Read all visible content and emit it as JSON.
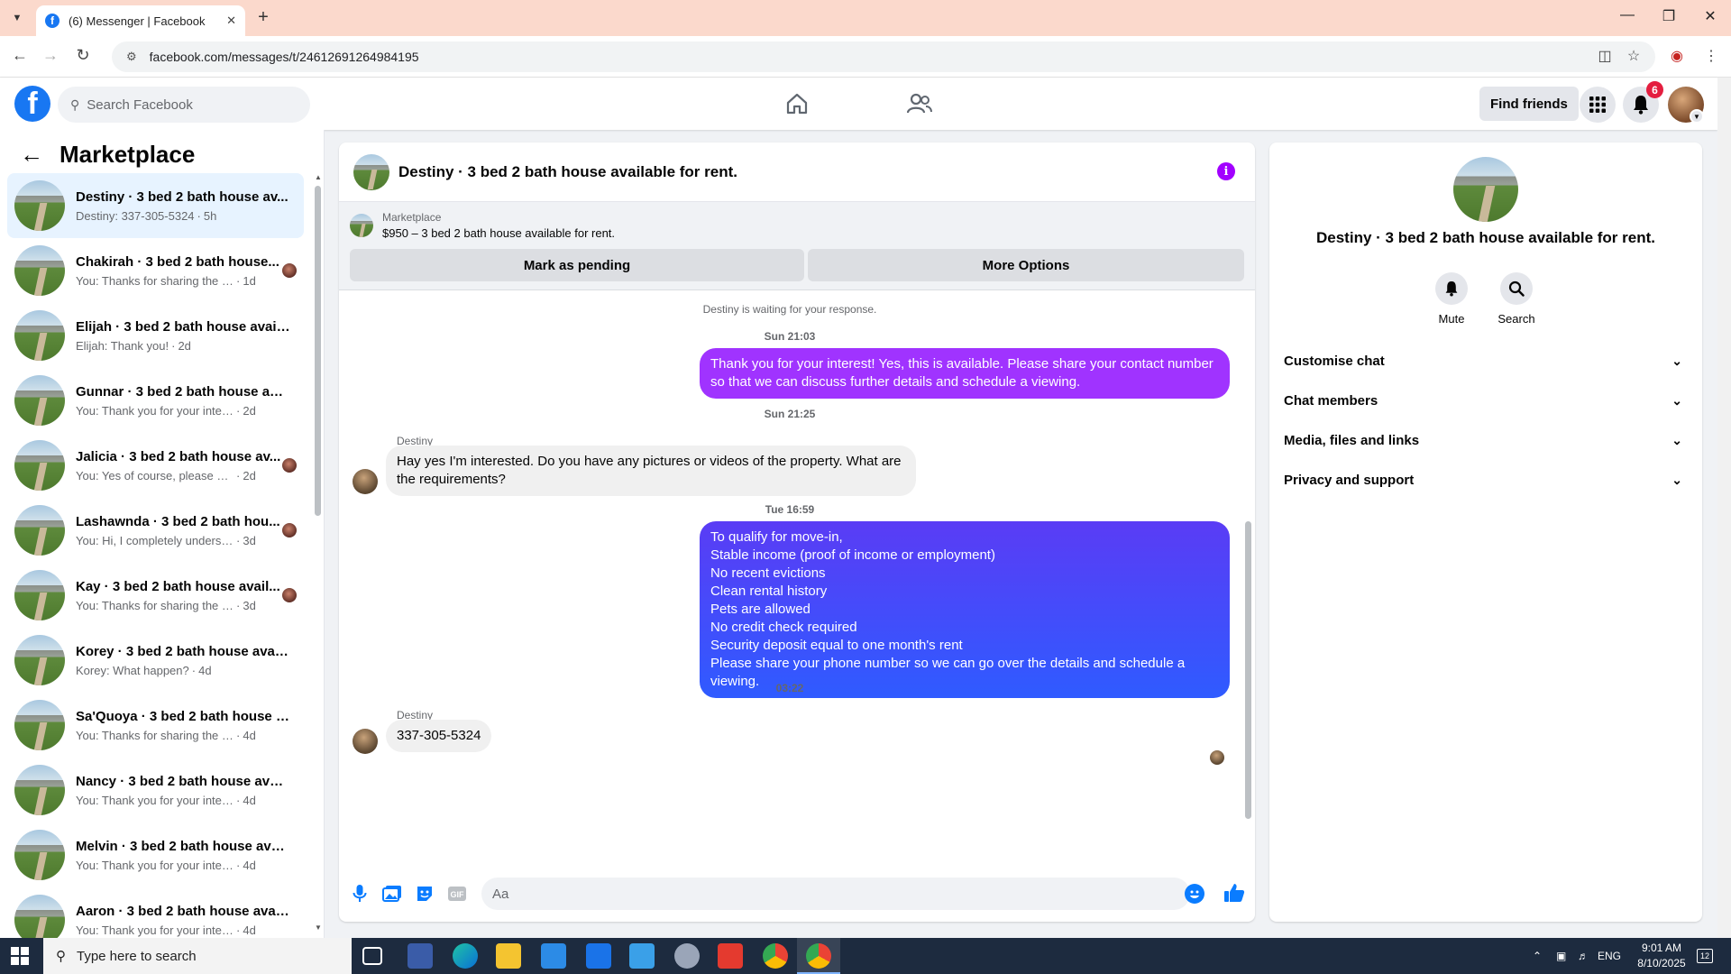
{
  "browser": {
    "tab_title": "(6) Messenger | Facebook",
    "url": "facebook.com/messages/t/24612691264984195"
  },
  "header": {
    "search_placeholder": "Search Facebook",
    "find_friends": "Find friends",
    "notification_count": "6"
  },
  "sidebar": {
    "title": "Marketplace",
    "conversations": [
      {
        "name": "Destiny · 3 bed 2 bath house av...",
        "snippet": "Destiny: 337-305-5324",
        "time": "5h",
        "active": true,
        "seen": false
      },
      {
        "name": "Chakirah · 3 bed 2 bath house...",
        "snippet": "You: Thanks for sharing the num...",
        "time": "1d",
        "active": false,
        "seen": true
      },
      {
        "name": "Elijah · 3 bed 2 bath house avail...",
        "snippet": "Elijah: Thank you!",
        "time": "2d",
        "active": false,
        "seen": false
      },
      {
        "name": "Gunnar · 3 bed 2 bath house ava...",
        "snippet": "You: Thank you for your interest! Ye...",
        "time": "2d",
        "active": false,
        "seen": false
      },
      {
        "name": "Jalicia · 3 bed 2 bath house av...",
        "snippet": "You: Yes of course, please share ...",
        "time": "2d",
        "active": false,
        "seen": true
      },
      {
        "name": "Lashawnda · 3 bed 2 bath hou...",
        "snippet": "You: Hi, I completely understand...",
        "time": "3d",
        "active": false,
        "seen": true
      },
      {
        "name": "Kay · 3 bed 2 bath house avail...",
        "snippet": "You: Thanks for sharing the num...",
        "time": "3d",
        "active": false,
        "seen": true
      },
      {
        "name": "Korey · 3 bed 2 bath house avail...",
        "snippet": "Korey: What happen?",
        "time": "4d",
        "active": false,
        "seen": false
      },
      {
        "name": "Sa'Quoya · 3 bed 2 bath house a...",
        "snippet": "You: Thanks for sharing the numbe...",
        "time": "4d",
        "active": false,
        "seen": false
      },
      {
        "name": "Nancy · 3 bed 2 bath house avail...",
        "snippet": "You: Thank you for your interest! Ye...",
        "time": "4d",
        "active": false,
        "seen": false
      },
      {
        "name": "Melvin · 3 bed 2 bath house avai...",
        "snippet": "You: Thank you for your interest! Ye...",
        "time": "4d",
        "active": false,
        "seen": false
      },
      {
        "name": "Aaron · 3 bed 2 bath house avail...",
        "snippet": "You: Thank you for your interest! Ye...",
        "time": "4d",
        "active": false,
        "seen": false
      }
    ]
  },
  "chat": {
    "title": "Destiny · 3 bed 2 bath house available for rent.",
    "marketplace_label": "Marketplace",
    "listing": "$950 – 3 bed 2 bath house available for rent.",
    "mark_pending": "Mark as pending",
    "more_options": "More Options",
    "waiting_note": "Destiny is waiting for your response.",
    "ts1": "Sun 21:03",
    "msg1": "Thank you for your interest! Yes, this is available. Please share your contact number so that we can discuss further details and schedule a viewing.",
    "ts2": "Sun 21:25",
    "sender": "Destiny",
    "msg2": "Hay yes I'm interested. Do you have any pictures or videos of the property. What are the requirements?",
    "ts3": "Tue 16:59",
    "msg3_lines": [
      "To qualify for move-in,",
      "Stable income (proof of income or employment)",
      "No recent evictions",
      "Clean rental history",
      "Pets are allowed",
      "No credit check required",
      "Security deposit equal to one month's rent",
      "Please share your phone number so we can go over the details and schedule a viewing."
    ],
    "ts4": "03:22",
    "msg4": "337-305-5324",
    "composer_placeholder": "Aa",
    "colors": {
      "bubble_purple": "#a033ff",
      "bubble_blue": "#2f5bff",
      "accent": "#0a7cff"
    }
  },
  "right_panel": {
    "title": "Destiny · 3 bed 2 bath house available for rent.",
    "mute": "Mute",
    "search": "Search",
    "sections": [
      "Customise chat",
      "Chat members",
      "Media, files and links",
      "Privacy and support"
    ]
  },
  "taskbar": {
    "search_placeholder": "Type here to search",
    "lang": "ENG",
    "time": "9:01 AM",
    "date": "8/10/2025",
    "notif_count": "12"
  }
}
